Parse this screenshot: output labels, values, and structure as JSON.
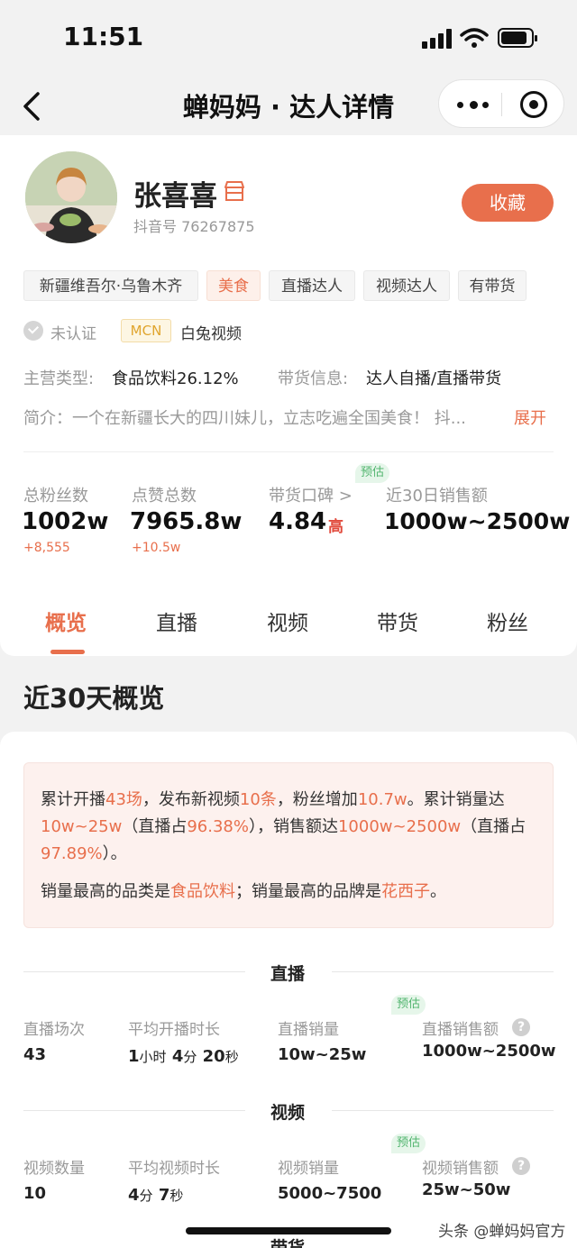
{
  "status_bar": {
    "time": "11:51"
  },
  "nav": {
    "title": "蝉妈妈 · 达人详情"
  },
  "profile": {
    "name": "张喜喜",
    "douyin_id": "抖音号 76267875",
    "favorite_label": "收藏",
    "tags": [
      {
        "label": "新疆维吾尔·乌鲁木齐",
        "highlight": false
      },
      {
        "label": "美食",
        "highlight": true
      },
      {
        "label": "直播达人",
        "highlight": false
      },
      {
        "label": "视频达人",
        "highlight": false
      },
      {
        "label": "有带货",
        "highlight": false
      }
    ],
    "verify_status": "未认证",
    "mcn_badge": "MCN",
    "mcn_name": "白兔视频",
    "category_label": "主营类型:",
    "category_value": "食品饮料26.12%",
    "sales_info_label": "带货信息:",
    "sales_info_value": "达人自播/直播带货",
    "intro": "简介：一个在新疆长大的四川妹儿，立志吃遍全国美食！ 抖...",
    "expand_label": "展开"
  },
  "stats": [
    {
      "label": "总粉丝数",
      "value": "1002w",
      "delta": "+8,555"
    },
    {
      "label": "点赞总数",
      "value": "7965.8w",
      "delta": "+10.5w"
    },
    {
      "label": "带货口碑 >",
      "value": "4.84",
      "level": "高",
      "badge": "预估"
    },
    {
      "label": "近30日销售额",
      "value": "1000w~2500w"
    }
  ],
  "tabs": [
    "概览",
    "直播",
    "视频",
    "带货",
    "粉丝"
  ],
  "section_title": "近30天概览",
  "summary": {
    "s1": "累计开播",
    "v1": "43场",
    "s2": "，发布新视频",
    "v2": "10条",
    "s3": "，粉丝增加",
    "v3": "10.7w",
    "s4": "。累计销量达",
    "v4": "10w~25w",
    "s5": "（直播占",
    "v5": "96.38%",
    "s6": "），销售额达",
    "v6": "1000w~2500w",
    "s7": "（直播占",
    "v7": "97.89%",
    "s8": "）。",
    "t1": "销量最高的品类是",
    "w1": "食品饮料",
    "t2": "；销量最高的品牌是",
    "w2": "花西子",
    "t3": "。"
  },
  "live": {
    "title": "直播",
    "badge": "预估",
    "metrics": [
      {
        "label": "直播场次",
        "value": "43"
      },
      {
        "label": "平均开播时长",
        "h": "1",
        "hu": "小时",
        "m": "4",
        "mu": "分",
        "s": "20",
        "su": "秒"
      },
      {
        "label": "直播销量",
        "value": "10w~25w"
      },
      {
        "label": "直播销售额",
        "value": "1000w~2500w"
      }
    ]
  },
  "video": {
    "title": "视频",
    "badge": "预估",
    "metrics": [
      {
        "label": "视频数量",
        "value": "10"
      },
      {
        "label": "平均视频时长",
        "m": "4",
        "mu": "分",
        "s": "7",
        "su": "秒"
      },
      {
        "label": "视频销量",
        "value": "5000~7500"
      },
      {
        "label": "视频销售额",
        "value": "25w~50w"
      }
    ]
  },
  "next_section_title": "带货",
  "watermark": "头条 @蝉妈妈官方",
  "question_mark": "?"
}
